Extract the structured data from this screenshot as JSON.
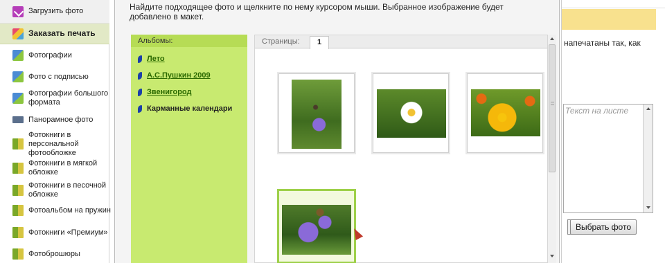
{
  "sidebar": {
    "items": [
      {
        "label": "Загрузить фото",
        "icon": "upload-icon"
      },
      {
        "label": "Заказать печать",
        "icon": "print-order-icon"
      },
      {
        "label": "Фотографии",
        "icon": "photos-icon"
      },
      {
        "label": "Фото с подписью",
        "icon": "captioned-photo-icon"
      },
      {
        "label": "Фотографии большого формата",
        "icon": "large-format-icon"
      },
      {
        "label": "Панорамное фото",
        "icon": "panorama-icon"
      },
      {
        "label": "Фотокниги в персональной фотообложке",
        "icon": "photobook-icon"
      },
      {
        "label": "Фотокниги в мягкой обложке",
        "icon": "photobook-icon"
      },
      {
        "label": "Фотокниги в песочной обложке",
        "icon": "photobook-icon"
      },
      {
        "label": "Фотоальбом на пружин",
        "icon": "photobook-icon"
      },
      {
        "label": "Фотокниги «Премиум»",
        "icon": "photobook-icon"
      },
      {
        "label": "Фотоброшюры",
        "icon": "photobook-icon"
      }
    ]
  },
  "dialog": {
    "instruction": "Найдите подходящее фото и щелкните по нему курсором мыши. Выбранное изображение будет добавлено в макет.",
    "albums_header": "Альбомы:",
    "albums": [
      {
        "label": "Лето",
        "link": true
      },
      {
        "label": "А.С.Пушкин 2009",
        "link": true
      },
      {
        "label": "Звенигород",
        "link": true
      },
      {
        "label": "Карманные календари",
        "link": false
      }
    ],
    "pages_label": "Страницы:",
    "current_page": "1",
    "photos": [
      {
        "name": "thistle-flower-bee",
        "selected": false
      },
      {
        "name": "daisy-flower",
        "selected": false
      },
      {
        "name": "yellow-flowers-field",
        "selected": false
      },
      {
        "name": "purple-cornflower-bee",
        "selected": true
      }
    ]
  },
  "background_page": {
    "text_fragment": "напечатаны так, как",
    "textarea_placeholder": "Текст на листе",
    "choose_photo_button": "Выбрать фото"
  },
  "colors": {
    "albums_panel": "#c8ea70",
    "selected_border": "#9ed04a",
    "highlight_band": "#f8e18e",
    "link_green": "#2b6a00"
  }
}
